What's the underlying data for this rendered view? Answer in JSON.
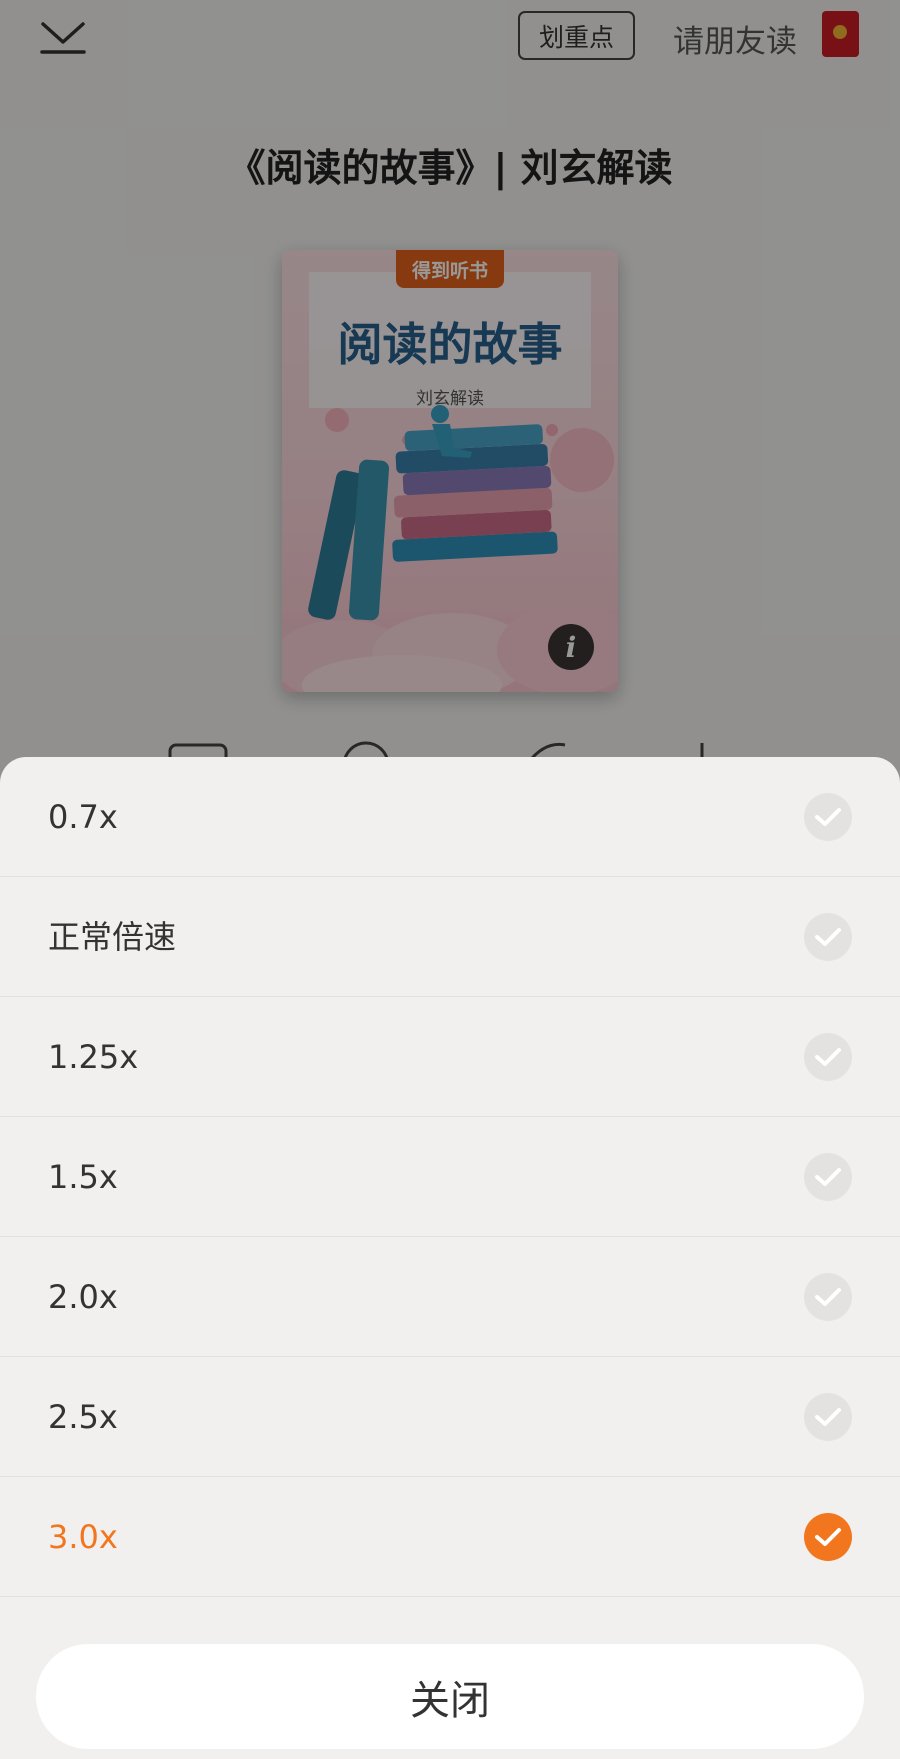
{
  "header": {
    "highlight_label": "划重点",
    "invite_label": "请朋友读"
  },
  "book": {
    "title": "《阅读的故事》| 刘玄解读",
    "cover_badge": "得到听书",
    "cover_title": "阅读的故事",
    "cover_subtitle": "刘玄解读",
    "info_glyph": "i"
  },
  "speed_sheet": {
    "options": [
      {
        "label": "0.7x",
        "selected": false
      },
      {
        "label": "正常倍速",
        "selected": false
      },
      {
        "label": "1.25x",
        "selected": false
      },
      {
        "label": "1.5x",
        "selected": false
      },
      {
        "label": "2.0x",
        "selected": false
      },
      {
        "label": "2.5x",
        "selected": false
      },
      {
        "label": "3.0x",
        "selected": true
      }
    ],
    "close_label": "关闭"
  },
  "icons": {
    "collapse": "chevron-down-icon",
    "redpacket": "red-packet-icon",
    "info": "info-icon",
    "check": "check-icon"
  },
  "colors": {
    "accent": "#f2761e",
    "check_inactive": "#e3e2e0",
    "redpacket": "#c81d25"
  }
}
